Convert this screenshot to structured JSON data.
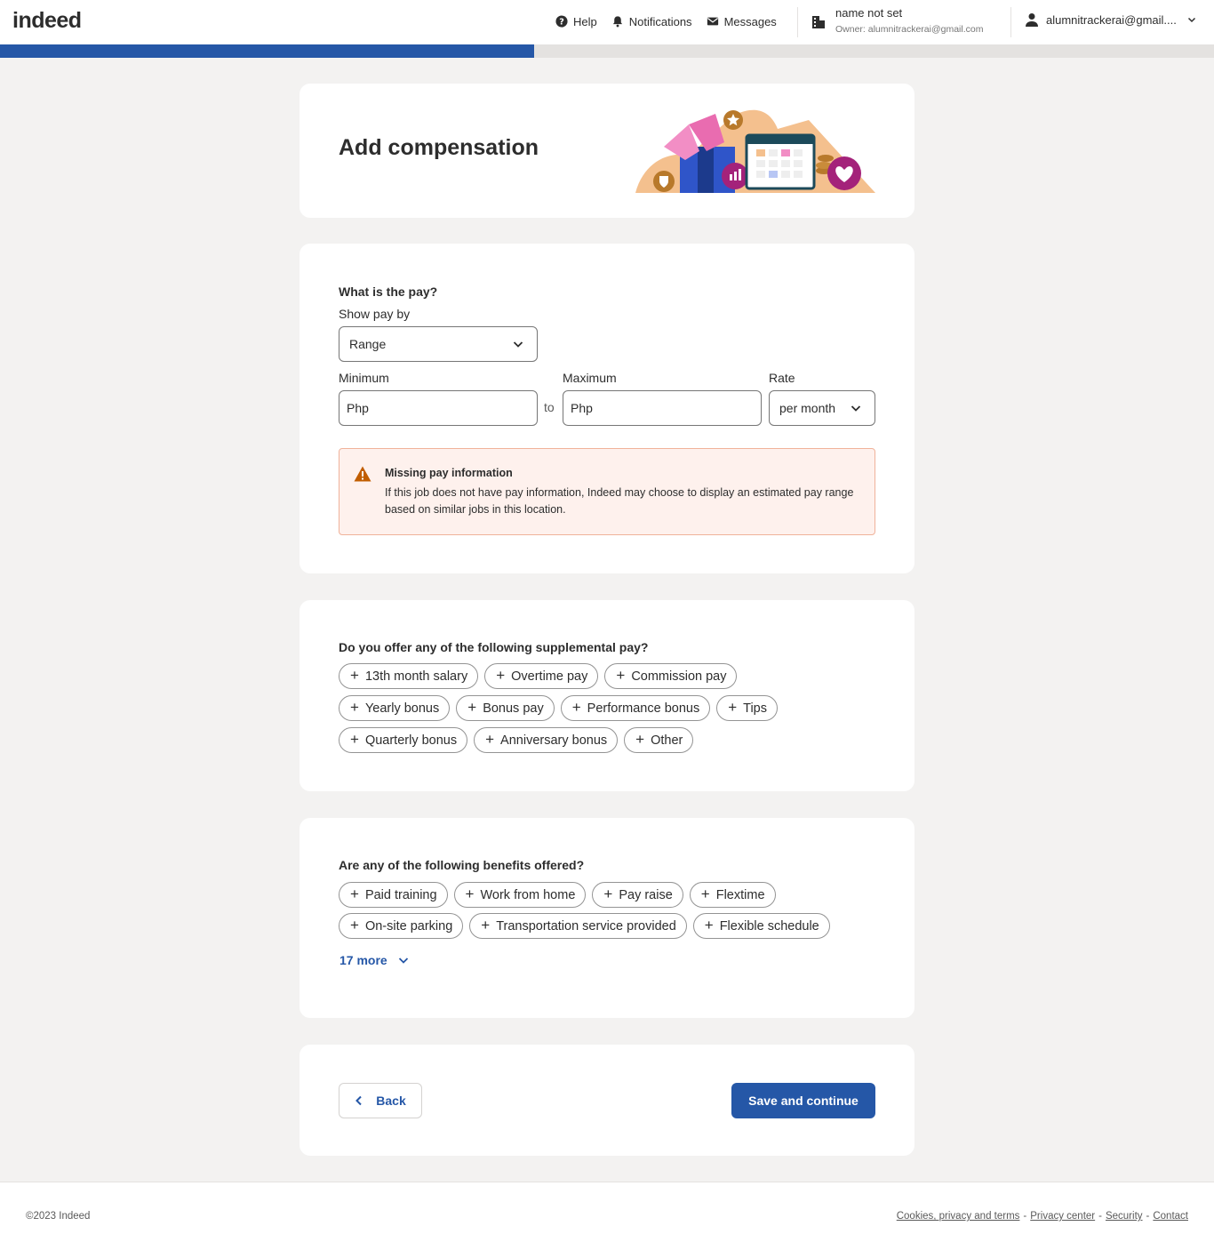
{
  "header": {
    "logo": "indeed",
    "nav": {
      "help": "Help",
      "notifications": "Notifications",
      "messages": "Messages"
    },
    "company_name": "name not set",
    "company_owner": "Owner: alumnitrackerai@gmail.com",
    "account": "alumnitrackerai@gmail...."
  },
  "progress_percent": 44,
  "title_card": {
    "title": "Add compensation"
  },
  "pay": {
    "question": "What is the pay?",
    "show_pay_by_label": "Show pay by",
    "show_pay_by_value": "Range",
    "minimum_label": "Minimum",
    "minimum_placeholder": "Php",
    "to": "to",
    "maximum_label": "Maximum",
    "maximum_placeholder": "Php",
    "rate_label": "Rate",
    "rate_value": "per month",
    "alert_title": "Missing pay information",
    "alert_body": "If this job does not have pay information, Indeed may choose to display an estimated pay range based on similar jobs in this location."
  },
  "supplemental": {
    "question": "Do you offer any of the following supplemental pay?",
    "options": [
      "13th month salary",
      "Overtime pay",
      "Commission pay",
      "Yearly bonus",
      "Bonus pay",
      "Performance bonus",
      "Tips",
      "Quarterly bonus",
      "Anniversary bonus",
      "Other"
    ]
  },
  "benefits": {
    "question": "Are any of the following benefits offered?",
    "options": [
      "Paid training",
      "Work from home",
      "Pay raise",
      "Flextime",
      "On-site parking",
      "Transportation service provided",
      "Flexible schedule"
    ],
    "more_label": "17 more"
  },
  "actions": {
    "back": "Back",
    "save": "Save and continue"
  },
  "footer": {
    "copyright": "©2023 Indeed",
    "links": [
      "Cookies, privacy and terms",
      "Privacy center",
      "Security",
      "Contact"
    ],
    "separator": "-"
  },
  "colors": {
    "brand_blue": "#2557a7",
    "alert_bg": "#fef1ed",
    "alert_border": "#f0b29a",
    "warning_icon": "#c15d00"
  }
}
